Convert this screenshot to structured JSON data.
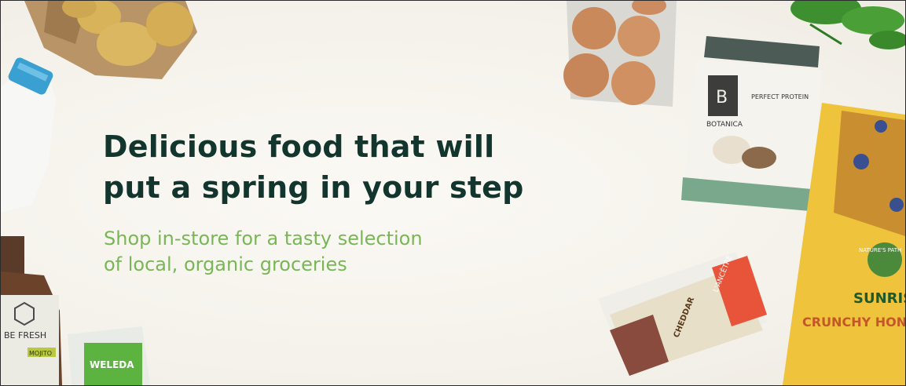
{
  "hero": {
    "headline_line1": "Delicious food that will",
    "headline_line2": "put a spring in your step",
    "subhead_line1": "Shop in-store for a tasty selection",
    "subhead_line2": "of local, organic groceries"
  },
  "products": {
    "protein_brand": "BOTANICA",
    "protein_name": "PERFECT PROTEIN",
    "juice_brand": "BE FRESH",
    "juice_flavor": "MOJITO",
    "lotion_brand": "WELEDA",
    "cheese_brand": "L'ANCÊTRE",
    "cheese_type": "CHEDDAR",
    "cereal_brand": "NATURE'S PATH",
    "cereal_name": "SUNRISE",
    "cereal_variant": "CRUNCHY HONEY"
  },
  "colors": {
    "headline": "#12352d",
    "subhead": "#79b657",
    "background": "#f4f1ea"
  }
}
